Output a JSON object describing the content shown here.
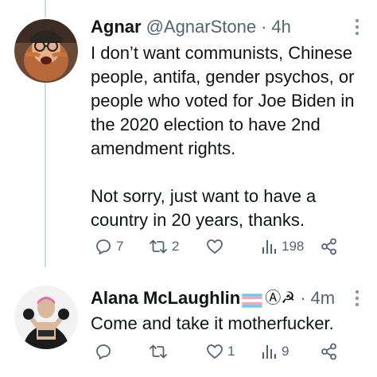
{
  "tweets": [
    {
      "display_name": "Agnar",
      "handle": "@AgnarStone",
      "separator": "·",
      "time": "4h",
      "more_icon": "ellipsis-vertical-icon",
      "paragraphs": [
        "I don’t want communists, Chinese people, antifa, gender psychos, or people who voted for Joe Biden in the 2020 election to have 2nd amendment rights.",
        "Not sorry, just want to have a country in 20 years, thanks."
      ],
      "actions": {
        "replies": "7",
        "retweets": "2",
        "likes": "",
        "views": "198"
      }
    },
    {
      "display_name": "Alana McLaughlin",
      "name_badges": "Ⓐ☭",
      "separator": "·",
      "time": "4m",
      "more_icon": "ellipsis-vertical-icon",
      "paragraphs": [
        "Come and take it motherfucker."
      ],
      "actions": {
        "replies": "",
        "retweets": "",
        "likes": "1",
        "views": "9"
      }
    }
  ],
  "colors": {
    "text_primary": "#0f1419",
    "text_secondary": "#536471",
    "thread_line": "#cfd9de",
    "flag_blue": "#5bcefa",
    "flag_pink": "#f5a9b8",
    "flag_white": "#ffffff"
  }
}
